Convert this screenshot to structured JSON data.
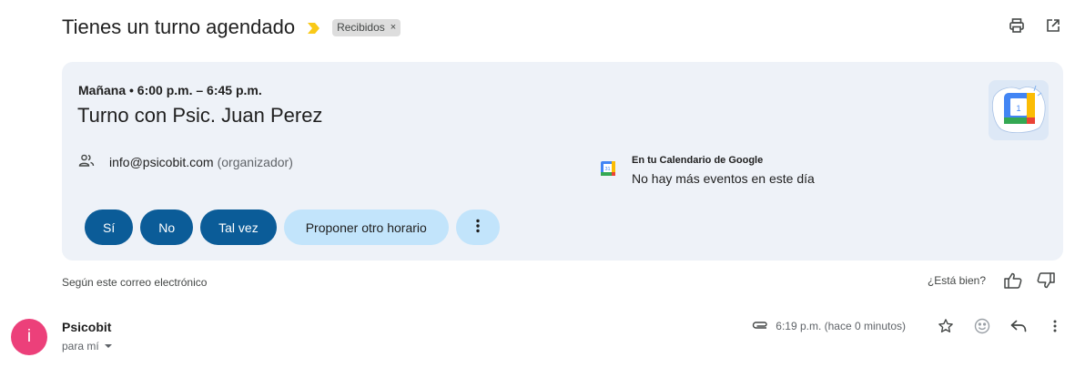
{
  "subject": "Tienes un turno agendado",
  "label_chip": {
    "text": "Recibidos",
    "remove": "×"
  },
  "toolbar": {
    "print_icon": "print-icon",
    "open_new_window_icon": "open-in-new-icon"
  },
  "invite": {
    "when": "Mañana • 6:00 p.m. – 6:45 p.m.",
    "title": "Turno con Psic. Juan Perez",
    "organizer_email": "info@psicobit.com",
    "organizer_role": "(organizador)",
    "calendar_header": "En tu Calendario de Google",
    "calendar_status": "No hay más eventos en este día",
    "calendar_logo_day": "1",
    "calendar_small_icon_day": "31",
    "rsvp": {
      "yes": "Sí",
      "no": "No",
      "maybe": "Tal vez",
      "propose": "Proponer otro horario",
      "more_icon": "more-vert-icon"
    }
  },
  "feedback": {
    "source": "Según este correo electrónico",
    "question": "¿Está bien?"
  },
  "message": {
    "avatar_letter": "i",
    "avatar_color": "#ec407a",
    "sender": "Psicobit",
    "to": "para mí",
    "time": "6:19 p.m. (hace 0 minutos)"
  },
  "colors": {
    "accent": "#0b5c98",
    "accent_light": "#c2e4fb",
    "card_bg": "#eef2f8",
    "importance": "#f9c918"
  }
}
